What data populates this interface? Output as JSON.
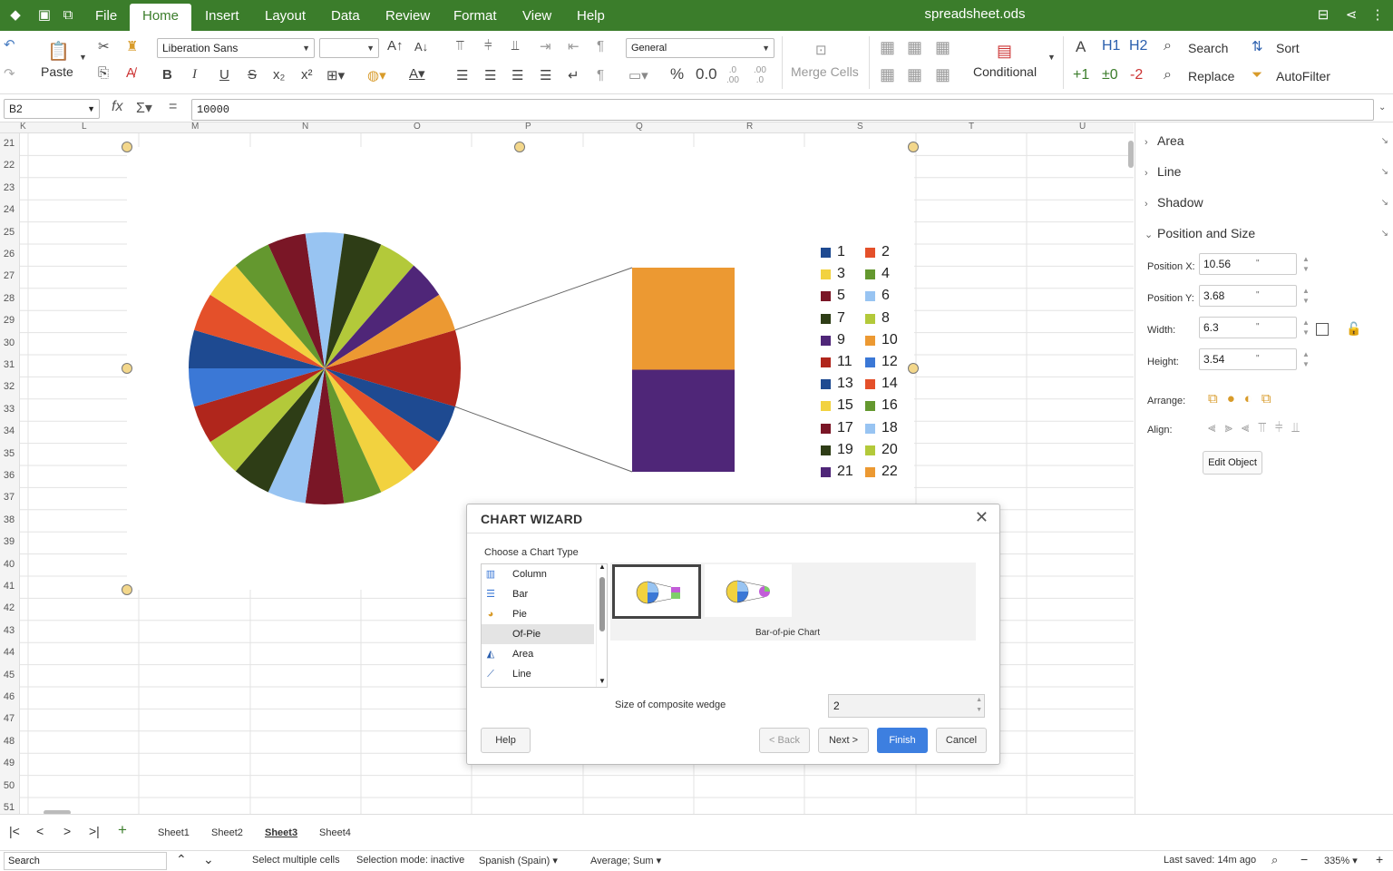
{
  "app": {
    "doc_title": "spreadsheet.ods",
    "menu_tabs": [
      "File",
      "Home",
      "Insert",
      "Layout",
      "Data",
      "Review",
      "Format",
      "View",
      "Help"
    ],
    "active_tab": "Home"
  },
  "ribbon": {
    "paste_label": "Paste",
    "font_name": "Liberation Sans",
    "font_size": "",
    "number_format": "General",
    "merge_cells": "Merge Cells",
    "conditional": "Conditional",
    "search": "Search",
    "replace": "Replace",
    "sort": "Sort",
    "autofilter": "AutoFilter",
    "h1": "H1",
    "h2": "H2",
    "plus1": "+1",
    "zero": "±0",
    "minus2": "-2",
    "percent": "%",
    "decimal": "0.0",
    "bold": "B",
    "italic": "I",
    "underline": "U",
    "strike": "S"
  },
  "formula_bar": {
    "cell_ref": "B2",
    "value": "10000"
  },
  "grid": {
    "columns": [
      "K",
      "L",
      "M",
      "N",
      "O",
      "P",
      "Q",
      "R",
      "S",
      "T",
      "U"
    ],
    "rows": [
      "21",
      "22",
      "23",
      "24",
      "25",
      "26",
      "27",
      "28",
      "29",
      "30",
      "31",
      "32",
      "33",
      "34",
      "35",
      "36",
      "37",
      "38",
      "39",
      "40",
      "41",
      "42",
      "43",
      "44",
      "45",
      "46",
      "47",
      "48",
      "49",
      "50",
      "51"
    ]
  },
  "chart_data": {
    "type": "pie",
    "subtype": "bar-of-pie",
    "categories": [
      "1",
      "2",
      "3",
      "4",
      "5",
      "6",
      "7",
      "8",
      "9",
      "10",
      "11",
      "12",
      "13",
      "14",
      "15",
      "16",
      "17",
      "18",
      "19",
      "20",
      "21",
      "22"
    ],
    "values": [
      1,
      1,
      1,
      1,
      1,
      1,
      1,
      1,
      1,
      1,
      1,
      1,
      1,
      1,
      1,
      1,
      1,
      1,
      1,
      1,
      1,
      1
    ],
    "composite_wedge_items": [
      "10",
      "9"
    ],
    "colors": [
      "#1e4a91",
      "#e4502a",
      "#f2d23f",
      "#64982f",
      "#7a1626",
      "#98c4f2",
      "#2e3d16",
      "#b3c93a",
      "#4f2678",
      "#ec9932",
      "#b0261c",
      "#3b78d6",
      "#1e4a91",
      "#e4502a",
      "#f2d23f",
      "#64982f",
      "#7a1626",
      "#98c4f2",
      "#2e3d16",
      "#b3c93a",
      "#4f2678",
      "#ec9932"
    ],
    "legend_position": "right",
    "title": ""
  },
  "sidebar": {
    "sections": [
      "Area",
      "Line",
      "Shadow",
      "Position and Size"
    ],
    "position_x_label": "Position X:",
    "position_x": "10.56",
    "position_y_label": "Position Y:",
    "position_y": "3.68",
    "width_label": "Width:",
    "width": "6.3",
    "height_label": "Height:",
    "height": "3.54",
    "unit": "\"",
    "arrange_label": "Arrange:",
    "align_label": "Align:",
    "edit_object": "Edit Object"
  },
  "sheets": {
    "tabs": [
      "Sheet1",
      "Sheet2",
      "Sheet3",
      "Sheet4"
    ],
    "active": "Sheet3"
  },
  "status": {
    "search_placeholder": "Search",
    "select_multiple": "Select multiple cells",
    "selection_mode": "Selection mode: inactive",
    "language": "Spanish (Spain)",
    "aggregate": "Average; Sum",
    "last_saved": "Last saved: 14m ago",
    "zoom": "335%"
  },
  "dialog": {
    "title": "CHART WIZARD",
    "choose_label": "Choose a Chart Type",
    "types": [
      "Column",
      "Bar",
      "Pie",
      "Of-Pie",
      "Area",
      "Line"
    ],
    "selected_type": "Of-Pie",
    "variant_label": "Bar-of-pie Chart",
    "wedge_label": "Size of composite wedge",
    "wedge_value": "2",
    "help": "Help",
    "back": "< Back",
    "next": "Next >",
    "finish": "Finish",
    "cancel": "Cancel"
  }
}
